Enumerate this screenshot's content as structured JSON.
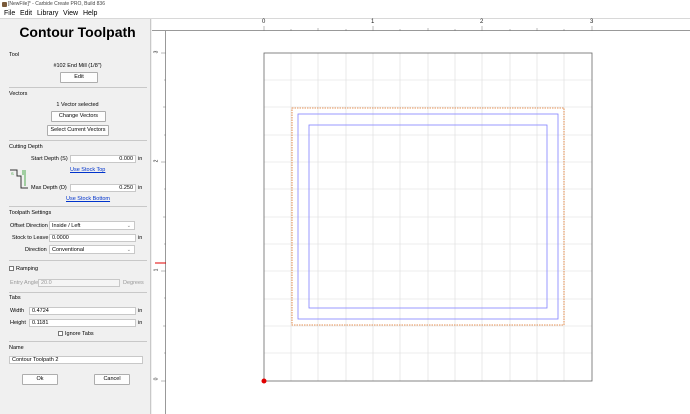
{
  "window": {
    "title": "[NewFile]* - Carbide Create PRO, Build 836"
  },
  "menu": [
    "File",
    "Edit",
    "Library",
    "View",
    "Help"
  ],
  "panel": {
    "title": "Contour Toolpath",
    "tool": {
      "heading": "Tool",
      "name": "#102 End Mill (1/8\")",
      "edit_label": "Edit"
    },
    "vectors": {
      "heading": "Vectors",
      "status": "1 Vector selected",
      "change_label": "Change Vectors",
      "select_label": "Select Current Vectors"
    },
    "cutting_depth": {
      "heading": "Cutting Depth",
      "start_label": "Start Depth (S)",
      "start_value": "0.000",
      "start_unit": "in",
      "use_stock_top": "Use Stock Top",
      "max_label": "Max Depth (D)",
      "max_value": "0.250",
      "max_unit": "in",
      "use_stock_bottom": "Use Stock Bottom"
    },
    "toolpath_settings": {
      "heading": "Toolpath Settings",
      "offset_label": "Offset Direction",
      "offset_value": "Inside / Left",
      "stock_label": "Stock to Leave",
      "stock_value": "0.0000",
      "stock_unit": "in",
      "direction_label": "Direction",
      "direction_value": "Conventional"
    },
    "ramping": {
      "label": "Ramping",
      "entry_label": "Entry Angle",
      "entry_value": "20.0",
      "entry_unit": "Degrees"
    },
    "tabs": {
      "heading": "Tabs",
      "width_label": "Width",
      "width_value": "0.4724",
      "width_unit": "in",
      "height_label": "Height",
      "height_value": "0.1181",
      "height_unit": "in",
      "ignore_label": "Ignore Tabs"
    },
    "name": {
      "heading": "Name",
      "value": "Contour Toolpath 2"
    },
    "ok_label": "Ok",
    "cancel_label": "Cancel"
  },
  "ruler": {
    "h_labels": [
      "0",
      "1",
      "2",
      "3"
    ],
    "v_labels": [
      "3",
      "2",
      "1",
      "0"
    ]
  },
  "colors": {
    "stock_outline": "#e07020",
    "toolpath": "#8080ff",
    "grid": "#dcdcdc",
    "origin": "#e00000"
  }
}
